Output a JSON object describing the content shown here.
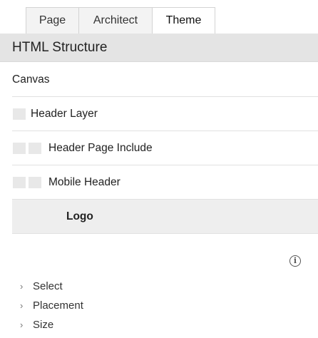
{
  "tabs": [
    {
      "label": "Page"
    },
    {
      "label": "Architect"
    },
    {
      "label": "Theme"
    }
  ],
  "active_tab": "Theme",
  "section": {
    "title": "HTML Structure"
  },
  "tree": [
    {
      "label": "Canvas",
      "depth": 0
    },
    {
      "label": "Header Layer",
      "depth": 1
    },
    {
      "label": "Header Page Include",
      "depth": 2
    },
    {
      "label": "Mobile Header",
      "depth": 2
    },
    {
      "label": "Logo",
      "depth": 3,
      "selected": true
    }
  ],
  "info_icon": "info-circle-icon",
  "accordion": [
    {
      "label": "Select"
    },
    {
      "label": "Placement"
    },
    {
      "label": "Size"
    }
  ],
  "colors": {
    "section_header_bg": "#e4e4e4",
    "selected_row_bg": "#eeeeee",
    "indent_box": "#e8e8e8"
  }
}
